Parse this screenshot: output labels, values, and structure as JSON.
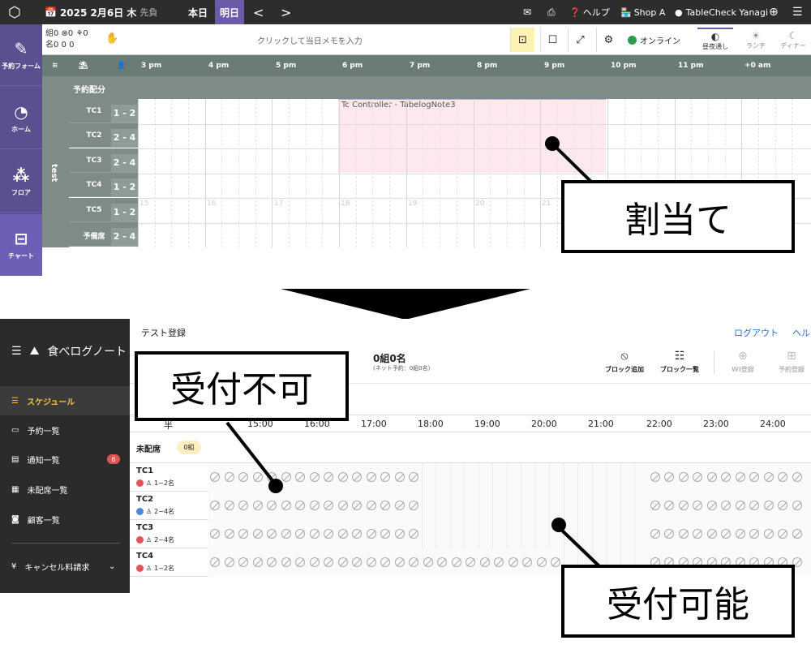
{
  "top": {
    "topbar": {
      "logo_icon": "app-logo-icon",
      "date": "2025 2月6日 木",
      "date_sub": "先負",
      "today": "本日",
      "tomorrow": "明日",
      "prev": "<",
      "next": ">",
      "help": "ヘルプ",
      "shop": "Shop A",
      "user": "TableCheck Yanagi"
    },
    "sidebar": [
      {
        "label": "予約フォーム",
        "icon": "edit-icon"
      },
      {
        "label": "ホーム",
        "icon": "dashboard-icon"
      },
      {
        "label": "フロア",
        "icon": "floor-icon"
      },
      {
        "label": "チャート",
        "icon": "chart-icon"
      }
    ],
    "counts": {
      "line1": "組0 ⊗0 ⚘0",
      "line2": "名0 0 0"
    },
    "memo_placeholder": "クリックして当日メモを入力",
    "online": "オンライン",
    "modes": [
      {
        "label": "昼夜通し"
      },
      {
        "label": "ランチ"
      },
      {
        "label": "ディナー"
      }
    ],
    "hours": [
      "3 pm",
      "4 pm",
      "5 pm",
      "6 pm",
      "7 pm",
      "8 pm",
      "9 pm",
      "10 pm",
      "11 pm",
      "+0 am"
    ],
    "subheader": "予約配分",
    "group": "test",
    "tables": [
      {
        "name": "TC1",
        "cap": "1 - 2"
      },
      {
        "name": "TC2",
        "cap": "2 - 4"
      },
      {
        "name": "TC3",
        "cap": "2 - 4"
      },
      {
        "name": "TC4",
        "cap": "1 - 2"
      },
      {
        "name": "TC5",
        "cap": "1 - 2"
      },
      {
        "name": "予備席",
        "cap": "2 - 4"
      }
    ],
    "reservation_text": "Tc Controller - TabelogNote3",
    "hour_marks": [
      "15",
      "16",
      "17",
      "18",
      "19",
      "20",
      "21"
    ],
    "callout": "割当て"
  },
  "bottom": {
    "sidebar": {
      "brand": "食べログノート",
      "items": [
        {
          "label": "スケジュール",
          "icon": "schedule-icon"
        },
        {
          "label": "予約一覧",
          "icon": "calendar-icon"
        },
        {
          "label": "通知一覧",
          "icon": "notification-icon",
          "badge": "6"
        },
        {
          "label": "未配席一覧",
          "icon": "unassigned-icon"
        },
        {
          "label": "顧客一覧",
          "icon": "customer-icon"
        },
        {
          "label": "キャンセル料請求",
          "icon": "yen-icon"
        }
      ]
    },
    "title": "テスト登録",
    "logout": "ログアウト",
    "help": "ヘル",
    "count": "0組0名",
    "count_sub": "(ネット予約：0組0名)",
    "tools": [
      {
        "label": "ブロック追加",
        "icon": "block-icon"
      },
      {
        "label": "ブロック一覧",
        "icon": "list-icon"
      },
      {
        "label": "WI登録",
        "icon": "plus-icon"
      },
      {
        "label": "予約登録",
        "icon": "calendar-add-icon"
      }
    ],
    "hours": [
      "半",
      "15:00",
      "16:00",
      "17:00",
      "18:00",
      "19:00",
      "20:00",
      "21:00",
      "22:00",
      "23:00",
      "24:00"
    ],
    "unassigned": {
      "label": "未配席",
      "count": "0組"
    },
    "tables": [
      {
        "name": "TC1",
        "cap": "1~2名",
        "color": "#e25555"
      },
      {
        "name": "TC2",
        "cap": "2~4名",
        "color": "#4a8bd6"
      },
      {
        "name": "TC3",
        "cap": "2~4名",
        "color": "#e25555"
      },
      {
        "name": "TC4",
        "cap": "1~2名",
        "color": "#e25555"
      }
    ],
    "callout_left": "受付不可",
    "callout_right": "受付可能"
  }
}
